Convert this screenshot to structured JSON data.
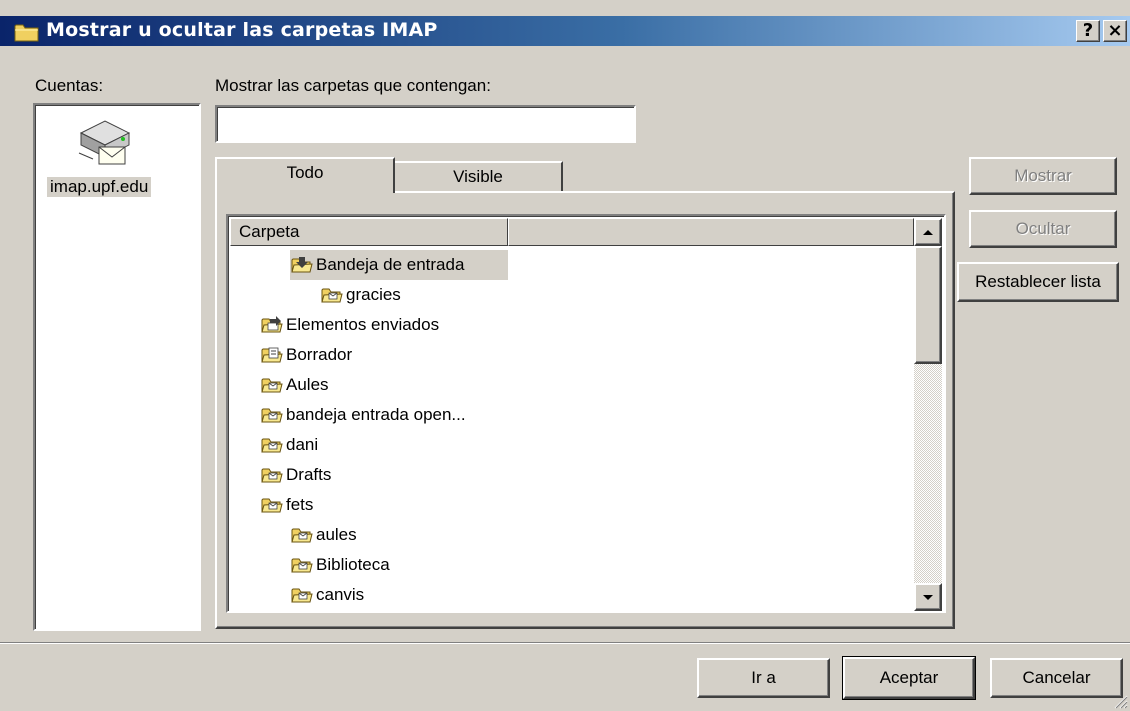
{
  "window": {
    "title": "Mostrar u ocultar las carpetas IMAP",
    "help_label": "?",
    "close_label": "×"
  },
  "accounts": {
    "label": "Cuentas:",
    "items": [
      {
        "name": "imap.upf.edu",
        "icon": "imap-server-icon"
      }
    ]
  },
  "filter": {
    "label": "Mostrar las carpetas que contengan:",
    "value": "",
    "placeholder": ""
  },
  "tabs": [
    {
      "label": "Todo",
      "selected": true
    },
    {
      "label": "Visible",
      "selected": false
    }
  ],
  "folder_list": {
    "column_header": "Carpeta",
    "rows": [
      {
        "name": "Bandeja de entrada",
        "icon": "inbox-icon",
        "indent": 1,
        "selected": true
      },
      {
        "name": "gracies",
        "icon": "folder-icon",
        "indent": 2
      },
      {
        "name": "Elementos enviados",
        "icon": "sent-items-icon",
        "indent": 0
      },
      {
        "name": "Borrador",
        "icon": "drafts-icon",
        "indent": 0
      },
      {
        "name": "Aules",
        "icon": "folder-icon",
        "indent": 0
      },
      {
        "name": "bandeja entrada open...",
        "icon": "folder-icon",
        "indent": 0
      },
      {
        "name": "dani",
        "icon": "folder-icon",
        "indent": 0
      },
      {
        "name": "Drafts",
        "icon": "folder-icon",
        "indent": 0
      },
      {
        "name": "fets",
        "icon": "folder-icon",
        "indent": 0
      },
      {
        "name": "aules",
        "icon": "folder-icon",
        "indent": 1
      },
      {
        "name": "Biblioteca",
        "icon": "folder-icon",
        "indent": 1
      },
      {
        "name": "canvis",
        "icon": "folder-icon",
        "indent": 1
      }
    ]
  },
  "side_buttons": {
    "show": {
      "label": "Mostrar",
      "enabled": false
    },
    "hide": {
      "label": "Ocultar",
      "enabled": false
    },
    "reset": {
      "label": "Restablecer lista",
      "enabled": true
    }
  },
  "footer_buttons": {
    "goto": "Ir a",
    "ok": "Aceptar",
    "cancel": "Cancelar"
  },
  "colors": {
    "title_gradient_start": "#0a246a",
    "title_gradient_end": "#a6caf0",
    "face": "#d4d0c8",
    "folder_yellow": "#f0d060"
  }
}
